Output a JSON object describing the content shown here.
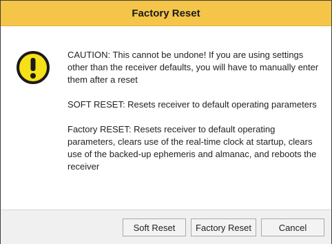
{
  "dialog": {
    "title": "Factory Reset",
    "icon": "exclamation-warning-icon",
    "colors": {
      "titlebar": "#f5c54a",
      "icon_fill": "#f7e017",
      "footer": "#f0f0f0"
    },
    "messages": [
      "CAUTION: This cannot be undone! If you are using settings other than the receiver defaults, you will have to manually enter them after a reset",
      "SOFT RESET: Resets receiver to default operating parameters",
      "Factory RESET: Resets receiver to default operating parameters, clears use of the real-time clock at startup, clears use of the backed-up ephemeris and almanac, and reboots the receiver"
    ],
    "buttons": {
      "soft_reset": "Soft Reset",
      "factory_reset": "Factory Reset",
      "cancel": "Cancel"
    }
  }
}
